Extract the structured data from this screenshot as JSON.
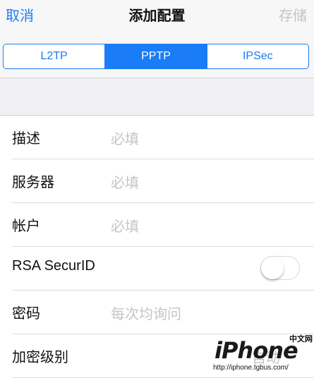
{
  "navbar": {
    "cancel_label": "取消",
    "title": "添加配置",
    "save_label": "存储"
  },
  "segments": [
    {
      "label": "L2TP",
      "selected": false
    },
    {
      "label": "PPTP",
      "selected": true
    },
    {
      "label": "IPSec",
      "selected": false
    }
  ],
  "form": {
    "description": {
      "label": "描述",
      "placeholder": "必填"
    },
    "server": {
      "label": "服务器",
      "placeholder": "必填"
    },
    "account": {
      "label": "帐户",
      "placeholder": "必填"
    },
    "rsa": {
      "label": "RSA SecurID",
      "enabled": false
    },
    "password": {
      "label": "密码",
      "placeholder": "每次均询问"
    },
    "encryption": {
      "label": "加密级别",
      "value": "自动"
    }
  },
  "watermark": {
    "brand": "iPhone",
    "subtitle": "中文网",
    "url": "http://iphone.tgbus.com/"
  },
  "colors": {
    "accent": "#1a7cf6",
    "placeholder": "#c4c4c8",
    "background": "#efeff4"
  }
}
